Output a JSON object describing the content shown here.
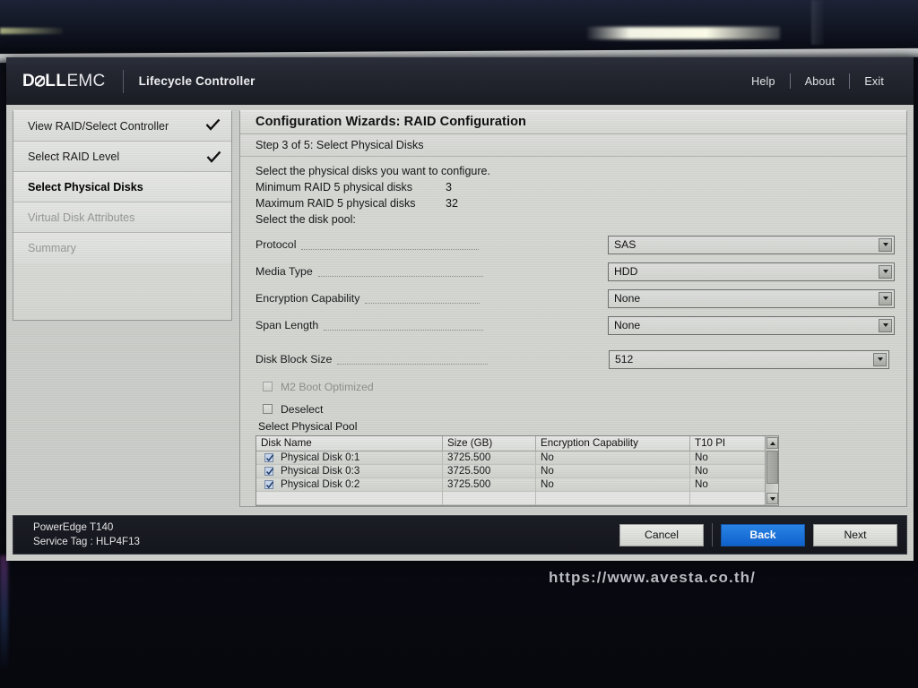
{
  "header": {
    "logo_dell": "D",
    "logo_dell_rest": "LL",
    "logo_emc": "EMC",
    "app_title": "Lifecycle Controller",
    "links": [
      "Help",
      "About",
      "Exit"
    ]
  },
  "sidebar": {
    "items": [
      {
        "label": "View RAID/Select Controller",
        "state": "done",
        "check": true,
        "check_inline": true
      },
      {
        "label": "Select RAID Level",
        "state": "done",
        "check": true,
        "check_inline": false
      },
      {
        "label": "Select Physical Disks",
        "state": "active",
        "check": false,
        "check_inline": false
      },
      {
        "label": "Virtual Disk Attributes",
        "state": "disabled",
        "check": false,
        "check_inline": false
      },
      {
        "label": "Summary",
        "state": "disabled",
        "check": false,
        "check_inline": false
      }
    ]
  },
  "main": {
    "panel_title": "Configuration Wizards: RAID Configuration",
    "step_text": "Step 3 of 5: Select Physical Disks",
    "intro": "Select the physical disks you want to configure.",
    "min_label": "Minimum RAID 5 physical disks",
    "min_value": "3",
    "max_label": "Maximum RAID 5 physical disks",
    "max_value": "32",
    "pool_prompt": "Select the disk pool:",
    "fields": [
      {
        "label": "Protocol",
        "value": "SAS",
        "dots": 198
      },
      {
        "label": "Media Type",
        "value": "HDD",
        "dots": 184
      },
      {
        "label": "Encryption Capability",
        "value": "None",
        "dots": 128
      },
      {
        "label": "Span Length",
        "value": "None",
        "dots": 178
      },
      {
        "label": "Disk Block Size",
        "value": "512",
        "dots": 168
      }
    ],
    "checkboxes": [
      {
        "label": "M2 Boot Optimized",
        "checked": false,
        "disabled": true
      },
      {
        "label": "Deselect",
        "checked": false,
        "disabled": false
      }
    ],
    "pool_label": "Select Physical Pool",
    "table": {
      "columns": [
        "Disk Name",
        "Size (GB)",
        "Encryption Capability",
        "T10 PI"
      ],
      "rows": [
        {
          "checked": true,
          "name": "Physical Disk 0:1",
          "size": "3725.500",
          "encryption": "No",
          "t10pi": "No"
        },
        {
          "checked": true,
          "name": "Physical Disk 0:3",
          "size": "3725.500",
          "encryption": "No",
          "t10pi": "No"
        },
        {
          "checked": true,
          "name": "Physical Disk 0:2",
          "size": "3725.500",
          "encryption": "No",
          "t10pi": "No"
        }
      ]
    }
  },
  "footer": {
    "model": "PowerEdge T140",
    "service_tag": "Service Tag : HLP4F13",
    "buttons": [
      {
        "label": "Cancel",
        "style": "default"
      },
      {
        "label": "Back",
        "style": "primary"
      },
      {
        "label": "Next",
        "style": "default"
      }
    ]
  },
  "watermark": "https://www.avesta.co.th/",
  "colors": {
    "accent_blue": "#1569d6",
    "header_dark": "#23262f",
    "screen_bg": "#d3d5d1"
  }
}
